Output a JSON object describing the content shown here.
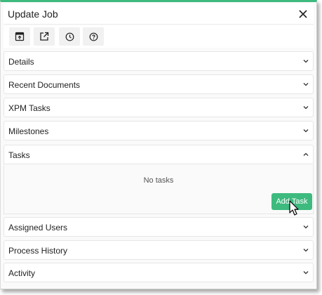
{
  "header": {
    "title": "Update Job",
    "close_icon": "close-icon"
  },
  "toolbar": {
    "buttons": [
      {
        "icon": "open-window-icon"
      },
      {
        "icon": "external-link-icon"
      },
      {
        "icon": "clock-icon"
      },
      {
        "icon": "help-icon"
      }
    ]
  },
  "sections": [
    {
      "label": "Details",
      "expanded": false
    },
    {
      "label": "Recent Documents",
      "expanded": false
    },
    {
      "label": "XPM Tasks",
      "expanded": false
    },
    {
      "label": "Milestones",
      "expanded": false
    },
    {
      "label": "Tasks",
      "expanded": true
    },
    {
      "label": "Assigned Users",
      "expanded": false
    },
    {
      "label": "Process History",
      "expanded": false
    },
    {
      "label": "Activity",
      "expanded": false
    }
  ],
  "tasks": {
    "empty_text": "No tasks",
    "add_button_label": "Add Task"
  },
  "colors": {
    "accent": "#3dba7e"
  }
}
